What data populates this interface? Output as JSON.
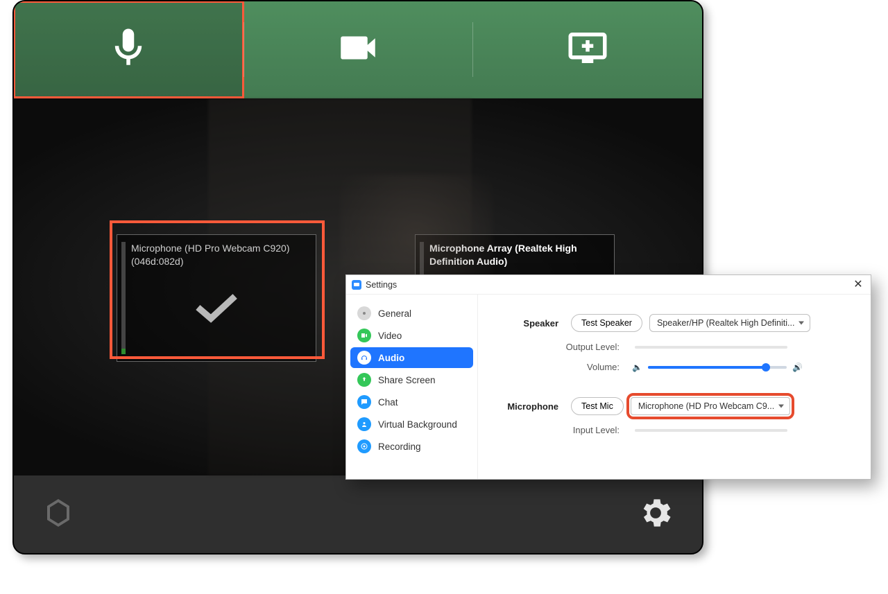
{
  "tabs": {
    "mic": "microphone",
    "cam": "camera",
    "screen": "share-screen"
  },
  "mic_cards": {
    "primary": {
      "title": "Microphone (HD Pro Webcam C920) (046d:082d)"
    },
    "secondary": {
      "title": "Microphone Array (Realtek High Definition Audio)"
    }
  },
  "settings": {
    "title": "Settings",
    "nav": {
      "general": "General",
      "video": "Video",
      "audio": "Audio",
      "share_screen": "Share Screen",
      "chat": "Chat",
      "virtual_bg": "Virtual Background",
      "recording": "Recording"
    },
    "speaker": {
      "label": "Speaker",
      "test_btn": "Test Speaker",
      "device": "Speaker/HP (Realtek High Definiti...",
      "output_label": "Output Level:",
      "volume_label": "Volume:"
    },
    "microphone": {
      "label": "Microphone",
      "test_btn": "Test Mic",
      "device": "Microphone (HD Pro Webcam C9...",
      "input_label": "Input Level:"
    }
  }
}
